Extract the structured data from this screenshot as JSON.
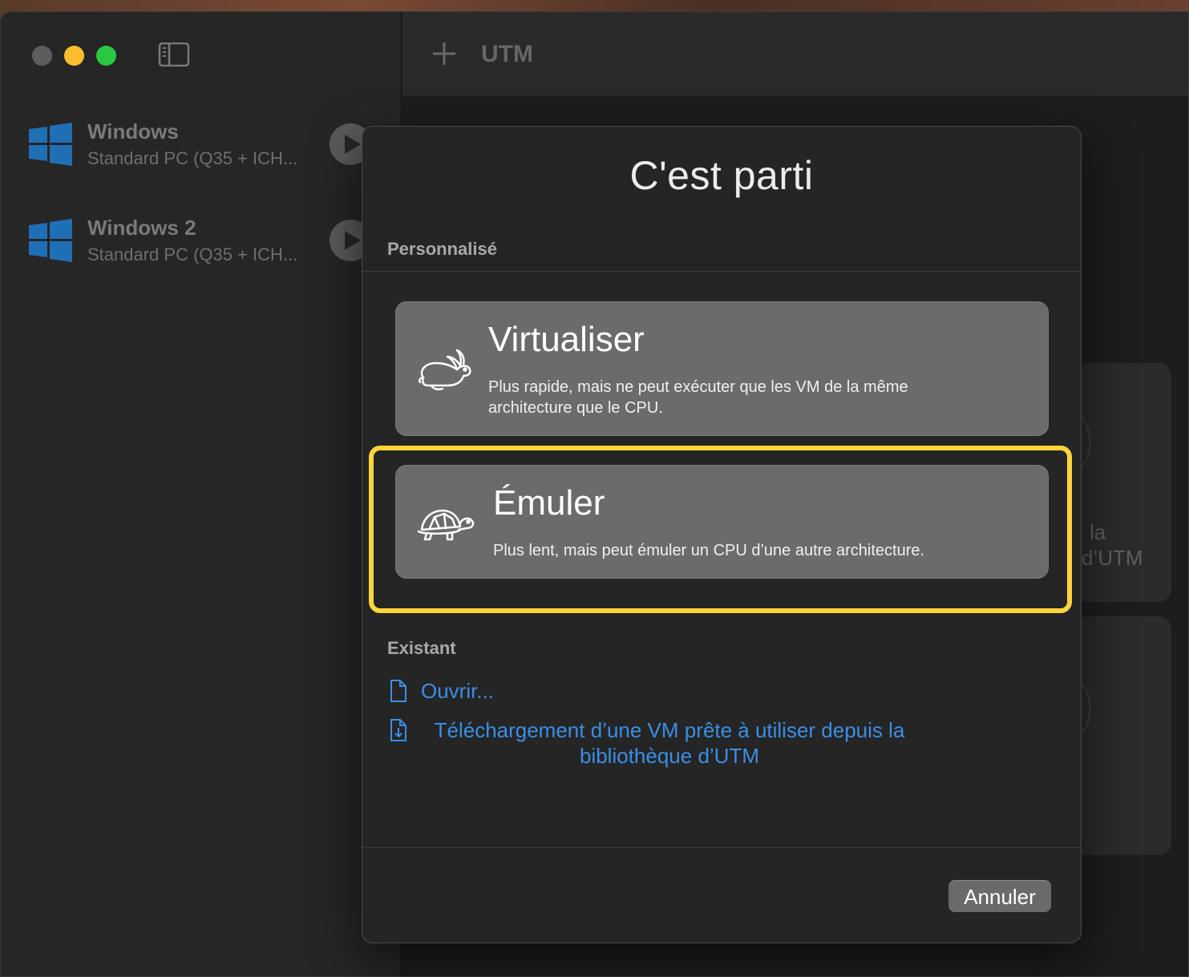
{
  "app": {
    "title": "UTM"
  },
  "sidebar": {
    "vms": [
      {
        "name": "Windows",
        "subtitle": "Standard PC (Q35 + ICH..."
      },
      {
        "name": "Windows 2",
        "subtitle": "Standard PC (Q35 + ICH..."
      }
    ]
  },
  "background": {
    "card_text_line1": "la",
    "card_text_line2": "d’UTM"
  },
  "dialog": {
    "title": "C'est parti",
    "custom_section": "Personnalisé",
    "options": [
      {
        "title": "Virtualiser",
        "description_line1": "Plus rapide, mais ne peut exécuter que les VM de la même",
        "description_line2": "architecture que le CPU.",
        "icon": "rabbit-icon"
      },
      {
        "title": "Émuler",
        "description": "Plus lent, mais peut émuler un CPU d’une autre architecture.",
        "icon": "turtle-icon",
        "highlighted": true
      }
    ],
    "existing_section": "Existant",
    "open_link": "Ouvrir...",
    "download_link_line1": "Téléchargement d’une VM prête à utiliser depuis la",
    "download_link_line2": "bibliothèque d’UTM",
    "cancel_label": "Annuler"
  },
  "colors": {
    "highlight": "#ffd43b",
    "link": "#3a8ee6",
    "windows_logo": "#1f6fb5"
  }
}
